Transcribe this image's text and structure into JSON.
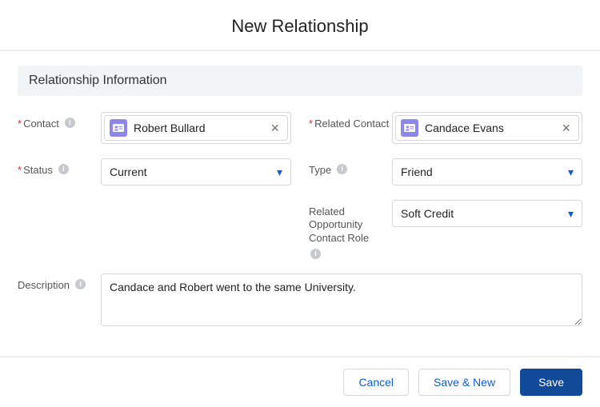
{
  "header": {
    "title": "New Relationship"
  },
  "section": {
    "title": "Relationship Information"
  },
  "fields": {
    "contact": {
      "label": "Contact",
      "required": true,
      "value": "Robert Bullard"
    },
    "related_contact": {
      "label": "Related Contact",
      "required": true,
      "value": "Candace Evans"
    },
    "status": {
      "label": "Status",
      "required": true,
      "value": "Current"
    },
    "type": {
      "label": "Type",
      "required": false,
      "value": "Friend"
    },
    "rel_opp_role": {
      "label": "Related Opportunity Contact Role",
      "required": false,
      "value": "Soft Credit"
    },
    "description": {
      "label": "Description",
      "required": false,
      "value": "Candace and Robert went to the same University."
    }
  },
  "footer": {
    "cancel": "Cancel",
    "save_new": "Save & New",
    "save": "Save"
  }
}
